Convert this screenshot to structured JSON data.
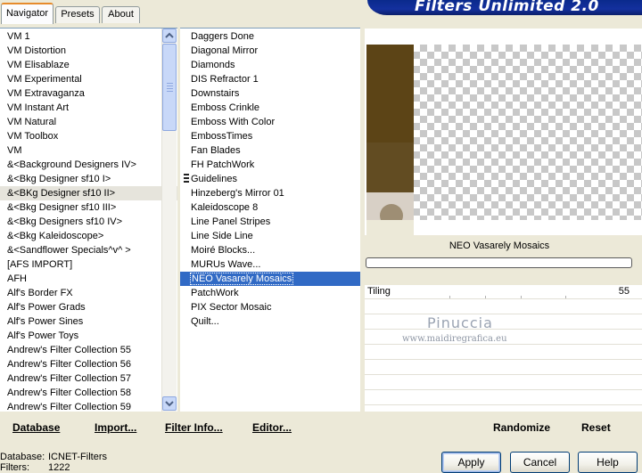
{
  "tabs": [
    {
      "label": "Navigator"
    },
    {
      "label": "Presets"
    },
    {
      "label": "About"
    }
  ],
  "banner": {
    "title": "Filters Unlimited 2.0"
  },
  "categories": [
    {
      "label": "VM 1"
    },
    {
      "label": "VM Distortion"
    },
    {
      "label": "VM Elisablaze"
    },
    {
      "label": "VM Experimental"
    },
    {
      "label": "VM Extravaganza"
    },
    {
      "label": "VM Instant Art"
    },
    {
      "label": "VM Natural"
    },
    {
      "label": "VM Toolbox"
    },
    {
      "label": "VM"
    },
    {
      "label": "&<Background Designers IV>"
    },
    {
      "label": "&<Bkg Designer sf10 I>"
    },
    {
      "label": "&<BKg Designer sf10 II>"
    },
    {
      "label": "&<Bkg Designer sf10 III>"
    },
    {
      "label": "&<Bkg Designers sf10 IV>"
    },
    {
      "label": "&<Bkg Kaleidoscope>"
    },
    {
      "label": "&<Sandflower Specials^v^ >"
    },
    {
      "label": "[AFS IMPORT]"
    },
    {
      "label": "AFH"
    },
    {
      "label": "Alf's Border FX"
    },
    {
      "label": "Alf's Power Grads"
    },
    {
      "label": "Alf's Power Sines"
    },
    {
      "label": "Alf's Power Toys"
    },
    {
      "label": "Andrew's Filter Collection 55"
    },
    {
      "label": "Andrew's Filter Collection 56"
    },
    {
      "label": "Andrew's Filter Collection 57"
    },
    {
      "label": "Andrew's Filter Collection 58"
    },
    {
      "label": "Andrew's Filter Collection 59"
    }
  ],
  "selected_category": "&<BKg Designer sf10 II>",
  "filters": [
    {
      "label": "Daggers Done"
    },
    {
      "label": "Diagonal Mirror"
    },
    {
      "label": "Diamonds"
    },
    {
      "label": "DIS Refractor 1"
    },
    {
      "label": "Downstairs"
    },
    {
      "label": "Emboss Crinkle"
    },
    {
      "label": "Emboss With Color"
    },
    {
      "label": "EmbossTimes"
    },
    {
      "label": "Fan Blades"
    },
    {
      "label": "FH PatchWork"
    },
    {
      "label": "Guidelines"
    },
    {
      "label": "Hinzeberg's Mirror 01"
    },
    {
      "label": "Kaleidoscope 8"
    },
    {
      "label": "Line Panel Stripes"
    },
    {
      "label": "Line Side Line"
    },
    {
      "label": "Moiré Blocks..."
    },
    {
      "label": "MURUs Wave..."
    },
    {
      "label": "NEO Vasarely Mosaics"
    },
    {
      "label": "PatchWork"
    },
    {
      "label": "PIX Sector Mosaic"
    },
    {
      "label": "Quilt..."
    }
  ],
  "selected_filter": "NEO Vasarely Mosaics",
  "preview": {
    "filter_name": "NEO Vasarely Mosaics",
    "progress": 0
  },
  "parameters": [
    {
      "label": "Tiling",
      "value": "55"
    }
  ],
  "watermark": {
    "name": "Pinuccia",
    "url": "www.maidiregrafica.eu"
  },
  "toolbar": {
    "database": "Database",
    "import": "Import...",
    "filter_info": "Filter Info...",
    "editor": "Editor...",
    "randomize": "Randomize",
    "reset": "Reset"
  },
  "status": {
    "database_label": "Database:",
    "database_value": "ICNET-Filters",
    "filters_label": "Filters:",
    "filters_value": "1222"
  },
  "dialog_buttons": {
    "apply": "Apply",
    "cancel": "Cancel",
    "help": "Help"
  },
  "colors": {
    "selection": "#316ac5",
    "banner": "#0a2a8c",
    "swatch": "#5c4416"
  }
}
